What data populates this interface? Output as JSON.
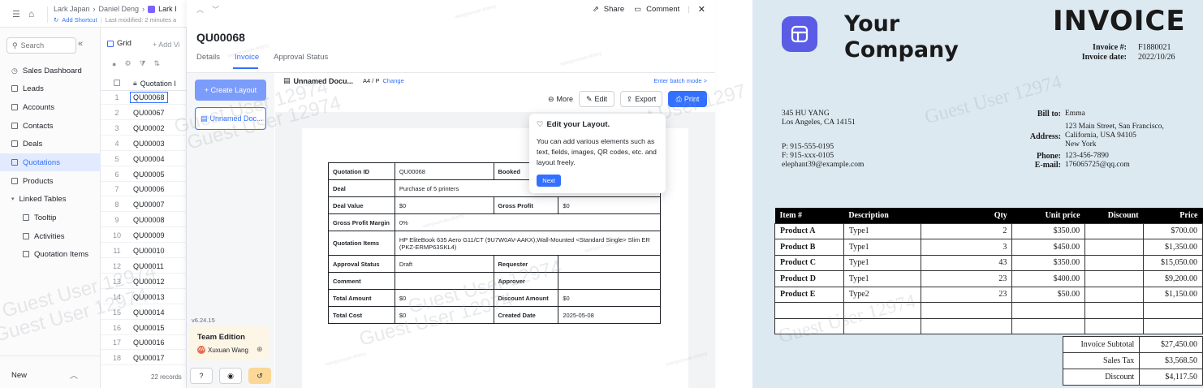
{
  "topbar": {
    "crumbs": [
      "Lark Japan",
      "Daniel Deng",
      "Lark I"
    ],
    "add_shortcut": "Add Shortcut",
    "last_modified": "Last modified: 2 minutes a"
  },
  "sidebar": {
    "search_placeholder": "Search",
    "items": [
      {
        "label": "Sales Dashboard"
      },
      {
        "label": "Leads"
      },
      {
        "label": "Accounts"
      },
      {
        "label": "Contacts"
      },
      {
        "label": "Deals"
      },
      {
        "label": "Quotations",
        "active": true
      },
      {
        "label": "Products"
      },
      {
        "label": "Linked Tables"
      },
      {
        "label": "Tooltip"
      },
      {
        "label": "Activities"
      },
      {
        "label": "Quotation Items"
      }
    ],
    "new_label": "New"
  },
  "grid": {
    "view_label": "Grid",
    "add_view": "+ Add Vi",
    "column_header": "Quotation I",
    "rows": [
      {
        "n": "1",
        "v": "QU00068"
      },
      {
        "n": "2",
        "v": "QU00067"
      },
      {
        "n": "3",
        "v": "QU00002"
      },
      {
        "n": "4",
        "v": "QU00003"
      },
      {
        "n": "5",
        "v": "QU00004"
      },
      {
        "n": "6",
        "v": "QU00005"
      },
      {
        "n": "7",
        "v": "QU00006"
      },
      {
        "n": "8",
        "v": "QU00007"
      },
      {
        "n": "9",
        "v": "QU00008"
      },
      {
        "n": "10",
        "v": "QU00009"
      },
      {
        "n": "11",
        "v": "QU00010"
      },
      {
        "n": "12",
        "v": "QU00011"
      },
      {
        "n": "13",
        "v": "QU00012"
      },
      {
        "n": "14",
        "v": "QU00013"
      },
      {
        "n": "15",
        "v": "QU00014"
      },
      {
        "n": "16",
        "v": "QU00015"
      },
      {
        "n": "17",
        "v": "QU00016"
      },
      {
        "n": "18",
        "v": "QU00017"
      }
    ],
    "records": "22 records"
  },
  "modal": {
    "share": "Share",
    "comment": "Comment",
    "title": "QU00068",
    "tabs": [
      "Details",
      "Invoice",
      "Approval Status"
    ],
    "create_layout": "+ Create Layout",
    "layout_item": "Unnamed Doc...",
    "doc_title": "Unnamed Docu...",
    "paper_size": "A4 / P",
    "change": "Change",
    "batch_mode": "Enter batch mode >",
    "more": "More",
    "edit": "Edit",
    "export": "Export",
    "print": "Print",
    "version": "v6.24.15",
    "edition": "Team Edition",
    "user": "Xuxuan Wang",
    "avatar_initials": "XW"
  },
  "tooltip": {
    "title": "Edit your Layout.",
    "body": "You can add various elements such as text, fields, images, QR codes, etc. and layout freely.",
    "next": "Next"
  },
  "quotation": {
    "r1": [
      "Quotation ID",
      "QU00068",
      "Booked",
      ""
    ],
    "r2": [
      "Deal",
      "Purchase of 5 printers"
    ],
    "r3": [
      "Deal Value",
      "$0",
      "Gross Profit",
      "$0"
    ],
    "r4": [
      "Gross Profit Margin",
      "0%"
    ],
    "r5": [
      "Quotation Items",
      "HP EliteBook 635 Aero G11/CT (9U7W0AV-AAKX),Wall-Mounted <Standard Single> Slim ER (PKZ-ERMP63SKL4)"
    ],
    "r6": [
      "Approval Status",
      "Draft",
      "Requester",
      ""
    ],
    "r7": [
      "Comment",
      "",
      "Approver",
      ""
    ],
    "r8": [
      "Total Amount",
      "$0",
      "Discount Amount",
      "$0"
    ],
    "r9": [
      "Total Cost",
      "$0",
      "Created Date",
      "2025-05-08"
    ]
  },
  "watermark": {
    "big": "Guest User 12974",
    "small": "wangxuxuan.sharry"
  },
  "invoice": {
    "company_line1": "Your",
    "company_line2": "Company",
    "title": "INVOICE",
    "invoice_no_label": "Invoice #:",
    "invoice_no": "F1880021",
    "invoice_date_label": "Invoice date:",
    "invoice_date": "2022/10/26",
    "from_address": [
      "345 HU YANG",
      "Los Angeles, CA 14151"
    ],
    "from_contact": [
      "P: 915-555-0195",
      "F: 915-xxx-0105",
      "elephant39@example.com"
    ],
    "bill_to_label": "Bill to:",
    "bill_to": "Emma",
    "address_label": "Address:",
    "address": [
      "123 Main Street, San Francisco,",
      "California, USA 94105",
      "New York"
    ],
    "phone_label": "Phone:",
    "phone": "123-456-7890",
    "email_label": "E-mail:",
    "email": "176065725@qq.com",
    "headers": [
      "Item #",
      "Description",
      "Qty",
      "Unit price",
      "Discount",
      "Price"
    ],
    "items": [
      [
        "Product A",
        "Type1",
        "2",
        "$350.00",
        "",
        "$700.00"
      ],
      [
        "Product B",
        "Type1",
        "3",
        "$450.00",
        "",
        "$1,350.00"
      ],
      [
        "Product C",
        "Type1",
        "43",
        "$350.00",
        "",
        "$15,050.00"
      ],
      [
        "Product D",
        "Type1",
        "23",
        "$400.00",
        "",
        "$9,200.00"
      ],
      [
        "Product E",
        "Type2",
        "23",
        "$50.00",
        "",
        "$1,150.00"
      ],
      [
        "",
        "",
        "",
        "",
        "",
        ""
      ],
      [
        "",
        "",
        "",
        "",
        "",
        ""
      ]
    ],
    "subtotal_label": "Invoice Subtotal",
    "subtotal": "$27,450.00",
    "tax_label": "Sales Tax",
    "tax": "$3,568.50",
    "discount_label": "Discount",
    "discount": "$4,117.50"
  }
}
